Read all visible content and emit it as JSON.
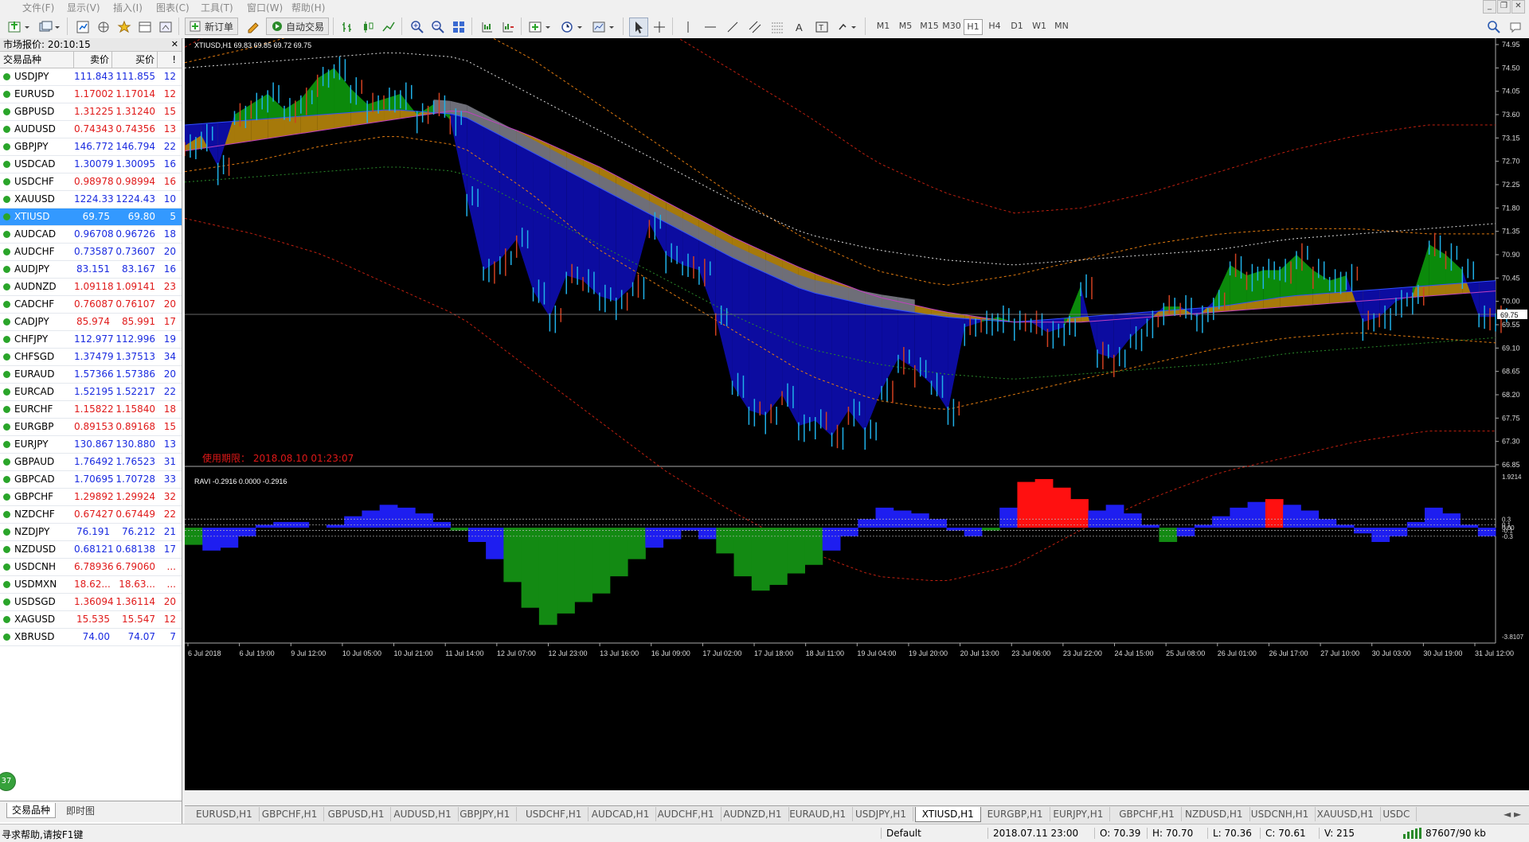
{
  "menu": [
    "文件(F)",
    "显示(V)",
    "插入(I)",
    "图表(C)",
    "工具(T)",
    "窗口(W)",
    "帮助(H)"
  ],
  "toolbar": {
    "new_order": "新订单",
    "auto_trade": "自动交易",
    "timeframes": [
      "M1",
      "M5",
      "M15",
      "M30",
      "H1",
      "H4",
      "D1",
      "W1",
      "MN"
    ],
    "active_timeframe": "H1"
  },
  "market_watch": {
    "title": "市场报价: 20:10:15",
    "headers": {
      "symbol": "交易品种",
      "bid": "卖价",
      "ask": "买价",
      "spread": "!"
    },
    "rows": [
      {
        "symbol": "USDJPY",
        "bid": "111.843",
        "ask": "111.855",
        "spread": "12",
        "dir": "up"
      },
      {
        "symbol": "EURUSD",
        "bid": "1.17002",
        "ask": "1.17014",
        "spread": "12",
        "dir": "dn"
      },
      {
        "symbol": "GBPUSD",
        "bid": "1.31225",
        "ask": "1.31240",
        "spread": "15",
        "dir": "dn"
      },
      {
        "symbol": "AUDUSD",
        "bid": "0.74343",
        "ask": "0.74356",
        "spread": "13",
        "dir": "dn"
      },
      {
        "symbol": "GBPJPY",
        "bid": "146.772",
        "ask": "146.794",
        "spread": "22",
        "dir": "up"
      },
      {
        "symbol": "USDCAD",
        "bid": "1.30079",
        "ask": "1.30095",
        "spread": "16",
        "dir": "up"
      },
      {
        "symbol": "USDCHF",
        "bid": "0.98978",
        "ask": "0.98994",
        "spread": "16",
        "dir": "dn"
      },
      {
        "symbol": "XAUUSD",
        "bid": "1224.33",
        "ask": "1224.43",
        "spread": "10",
        "dir": "up"
      },
      {
        "symbol": "XTIUSD",
        "bid": "69.75",
        "ask": "69.80",
        "spread": "5",
        "dir": "sel"
      },
      {
        "symbol": "AUDCAD",
        "bid": "0.96708",
        "ask": "0.96726",
        "spread": "18",
        "dir": "up"
      },
      {
        "symbol": "AUDCHF",
        "bid": "0.73587",
        "ask": "0.73607",
        "spread": "20",
        "dir": "up"
      },
      {
        "symbol": "AUDJPY",
        "bid": "83.151",
        "ask": "83.167",
        "spread": "16",
        "dir": "up"
      },
      {
        "symbol": "AUDNZD",
        "bid": "1.09118",
        "ask": "1.09141",
        "spread": "23",
        "dir": "dn"
      },
      {
        "symbol": "CADCHF",
        "bid": "0.76087",
        "ask": "0.76107",
        "spread": "20",
        "dir": "dn"
      },
      {
        "symbol": "CADJPY",
        "bid": "85.974",
        "ask": "85.991",
        "spread": "17",
        "dir": "dn"
      },
      {
        "symbol": "CHFJPY",
        "bid": "112.977",
        "ask": "112.996",
        "spread": "19",
        "dir": "up"
      },
      {
        "symbol": "CHFSGD",
        "bid": "1.37479",
        "ask": "1.37513",
        "spread": "34",
        "dir": "up"
      },
      {
        "symbol": "EURAUD",
        "bid": "1.57366",
        "ask": "1.57386",
        "spread": "20",
        "dir": "up"
      },
      {
        "symbol": "EURCAD",
        "bid": "1.52195",
        "ask": "1.52217",
        "spread": "22",
        "dir": "up"
      },
      {
        "symbol": "EURCHF",
        "bid": "1.15822",
        "ask": "1.15840",
        "spread": "18",
        "dir": "dn"
      },
      {
        "symbol": "EURGBP",
        "bid": "0.89153",
        "ask": "0.89168",
        "spread": "15",
        "dir": "dn"
      },
      {
        "symbol": "EURJPY",
        "bid": "130.867",
        "ask": "130.880",
        "spread": "13",
        "dir": "up"
      },
      {
        "symbol": "GBPAUD",
        "bid": "1.76492",
        "ask": "1.76523",
        "spread": "31",
        "dir": "up"
      },
      {
        "symbol": "GBPCAD",
        "bid": "1.70695",
        "ask": "1.70728",
        "spread": "33",
        "dir": "up"
      },
      {
        "symbol": "GBPCHF",
        "bid": "1.29892",
        "ask": "1.29924",
        "spread": "32",
        "dir": "dn"
      },
      {
        "symbol": "NZDCHF",
        "bid": "0.67427",
        "ask": "0.67449",
        "spread": "22",
        "dir": "dn"
      },
      {
        "symbol": "NZDJPY",
        "bid": "76.191",
        "ask": "76.212",
        "spread": "21",
        "dir": "up"
      },
      {
        "symbol": "NZDUSD",
        "bid": "0.68121",
        "ask": "0.68138",
        "spread": "17",
        "dir": "up"
      },
      {
        "symbol": "USDCNH",
        "bid": "6.78936",
        "ask": "6.79060",
        "spread": "...",
        "dir": "dn"
      },
      {
        "symbol": "USDMXN",
        "bid": "18.62...",
        "ask": "18.63...",
        "spread": "...",
        "dir": "dn"
      },
      {
        "symbol": "USDSGD",
        "bid": "1.36094",
        "ask": "1.36114",
        "spread": "20",
        "dir": "dn"
      },
      {
        "symbol": "XAGUSD",
        "bid": "15.535",
        "ask": "15.547",
        "spread": "12",
        "dir": "dn"
      },
      {
        "symbol": "XBRUSD",
        "bid": "74.00",
        "ask": "74.07",
        "spread": "7",
        "dir": "up"
      }
    ],
    "tabs": [
      "交易品种",
      "即时图"
    ],
    "badge": "37"
  },
  "chart_data": [
    {
      "type": "line",
      "title": "XTIUSD,H1  69.83 69.85 69.72 69.75",
      "watermark": "使用期限： 2018.08.10 01:23:07",
      "y_ticks": [
        "74.95",
        "74.50",
        "74.05",
        "73.60",
        "73.15",
        "72.70",
        "72.25",
        "71.80",
        "71.35",
        "70.90",
        "70.45",
        "70.00",
        "69.55",
        "69.10",
        "68.65",
        "68.20",
        "67.75",
        "67.30",
        "66.85"
      ],
      "ylim": [
        66.85,
        74.95
      ],
      "current_price": "69.75",
      "x_ticks": [
        "6 Jul 2018",
        "6 Jul 19:00",
        "9 Jul 12:00",
        "10 Jul 05:00",
        "10 Jul 21:00",
        "11 Jul 14:00",
        "12 Jul 07:00",
        "12 Jul 23:00",
        "13 Jul 16:00",
        "16 Jul 09:00",
        "17 Jul 02:00",
        "17 Jul 18:00",
        "18 Jul 11:00",
        "19 Jul 04:00",
        "19 Jul 20:00",
        "20 Jul 13:00",
        "23 Jul 06:00",
        "23 Jul 22:00",
        "24 Jul 15:00",
        "25 Jul 08:00",
        "26 Jul 01:00",
        "26 Jul 17:00",
        "27 Jul 10:00",
        "30 Jul 03:00",
        "30 Jul 19:00",
        "31 Jul 12:00"
      ],
      "close_path": [
        73.0,
        73.2,
        72.6,
        73.6,
        73.8,
        74.0,
        73.7,
        73.9,
        74.3,
        74.5,
        74.1,
        73.8,
        73.9,
        74.0,
        73.6,
        73.8,
        73.5,
        72.0,
        70.6,
        70.8,
        71.2,
        70.2,
        69.7,
        70.5,
        70.4,
        70.1,
        70.0,
        70.3,
        71.5,
        70.9,
        70.7,
        70.6,
        69.7,
        68.4,
        67.9,
        67.8,
        68.2,
        67.6,
        67.7,
        67.4,
        67.9,
        67.5,
        68.3,
        68.9,
        68.7,
        68.4,
        67.9,
        69.5,
        69.6,
        69.7,
        69.6,
        69.6,
        69.4,
        69.5,
        70.3,
        69.0,
        68.9,
        69.3,
        69.6,
        69.9,
        69.9,
        69.7,
        70.0,
        70.7,
        70.5,
        70.6,
        70.6,
        70.9,
        70.6,
        70.4,
        70.5,
        69.6,
        69.7,
        70.0,
        70.1,
        71.1,
        70.9,
        70.6,
        69.7,
        69.7
      ],
      "band_outer_up": [
        74.9,
        75.6,
        76.1,
        76.6,
        76.8,
        76.6,
        75.9,
        75.2,
        74.4,
        73.6,
        72.7,
        72.1,
        71.7,
        71.8,
        72.1,
        72.5,
        72.9,
        73.2,
        73.4,
        73.4
      ],
      "band_mid_up": [
        74.6,
        74.9,
        75.3,
        75.6,
        75.4,
        74.7,
        73.8,
        72.9,
        72.0,
        71.2,
        70.6,
        70.3,
        70.5,
        70.8,
        71.1,
        71.3,
        71.4,
        71.4,
        71.3,
        71.3
      ],
      "band_mid_dn": [
        72.5,
        72.7,
        73.0,
        73.2,
        73.0,
        72.1,
        71.0,
        70.2,
        69.4,
        68.6,
        68.1,
        67.9,
        68.2,
        68.5,
        68.8,
        69.1,
        69.3,
        69.4,
        69.3,
        69.2
      ],
      "band_outer_dn": [
        71.6,
        71.3,
        70.9,
        70.3,
        69.7,
        68.7,
        67.7,
        66.7,
        65.9,
        65.2,
        64.7,
        64.6,
        64.9,
        65.6,
        66.2,
        66.7,
        67.0,
        67.3,
        67.5,
        67.5
      ],
      "ma_fast": [
        73.4,
        73.5,
        73.6,
        73.7,
        73.6,
        72.9,
        72.2,
        71.5,
        70.8,
        70.2,
        69.9,
        69.7,
        69.6,
        69.7,
        69.8,
        69.9,
        70.1,
        70.2,
        70.3,
        70.4
      ],
      "ma_slow": [
        72.9,
        73.1,
        73.3,
        73.5,
        73.7,
        73.2,
        72.6,
        71.9,
        71.2,
        70.6,
        70.1,
        69.8,
        69.6,
        69.6,
        69.7,
        69.8,
        69.9,
        70.0,
        70.1,
        70.2
      ]
    },
    {
      "type": "bar",
      "title": "RAVI -0.2916 0.0000 -0.2916",
      "y_ticks": [
        "1.9214",
        "0.3",
        "0.1",
        "0.00",
        "-0.1",
        "-0.3",
        "-3.8107"
      ],
      "ylim": [
        -3.8107,
        1.9214
      ],
      "values": [
        -0.6,
        -0.8,
        -0.7,
        -0.3,
        0.1,
        0.2,
        0.2,
        0.0,
        0.1,
        0.4,
        0.6,
        0.8,
        0.7,
        0.5,
        0.2,
        -0.1,
        -0.5,
        -1.1,
        -1.9,
        -2.8,
        -3.4,
        -3.0,
        -2.6,
        -2.3,
        -1.7,
        -1.1,
        -0.7,
        -0.4,
        -0.1,
        -0.4,
        -0.9,
        -1.7,
        -2.2,
        -2.0,
        -1.6,
        -1.3,
        -0.8,
        -0.3,
        0.3,
        0.7,
        0.6,
        0.5,
        0.3,
        -0.1,
        -0.3,
        -0.1,
        0.7,
        1.6,
        1.7,
        1.4,
        1.0,
        0.6,
        0.8,
        0.5,
        0.1,
        -0.5,
        -0.3,
        0.1,
        0.4,
        0.7,
        0.9,
        1.0,
        0.8,
        0.6,
        0.3,
        0.1,
        -0.2,
        -0.5,
        -0.3,
        0.2,
        0.7,
        0.5,
        0.1,
        -0.3
      ],
      "colors": {
        "pos_weak": "#1e1ef0",
        "pos_strong": "#ff1010",
        "neg_weak": "#1e1ef0",
        "neg_strong": "#138a13"
      }
    }
  ],
  "chart_tabs": [
    "EURUSD,H1",
    "GBPCHF,H1",
    "GBPUSD,H1",
    "AUDUSD,H1",
    "GBPJPY,H1",
    "USDCHF,H1",
    "AUDCAD,H1",
    "AUDCHF,H1",
    "AUDNZD,H1",
    "EURAUD,H1",
    "USDJPY,H1",
    "XTIUSD,H1",
    "EURGBP,H1",
    "EURJPY,H1",
    "GBPCHF,H1",
    "NZDUSD,H1",
    "USDCNH,H1",
    "XAUUSD,H1",
    "USDC"
  ],
  "active_chart_tab": "XTIUSD,H1",
  "status": {
    "help": "寻求帮助,请按F1键",
    "profile": "Default",
    "datetime": "2018.07.11 23:00",
    "open": "O: 70.39",
    "high": "H: 70.70",
    "low": "L: 70.36",
    "close": "C: 70.61",
    "volume": "V: 215",
    "traffic": "87607/90 kb"
  },
  "colors": {
    "chart_bg": "#000000",
    "bull_fill": "#0b8a0b",
    "bear_fill": "#0c0ca0",
    "ma_band_orange": "#b8860b",
    "gray_band": "#6e6e78",
    "candle": "#1fb0e8",
    "candle_red": "#d04020"
  }
}
